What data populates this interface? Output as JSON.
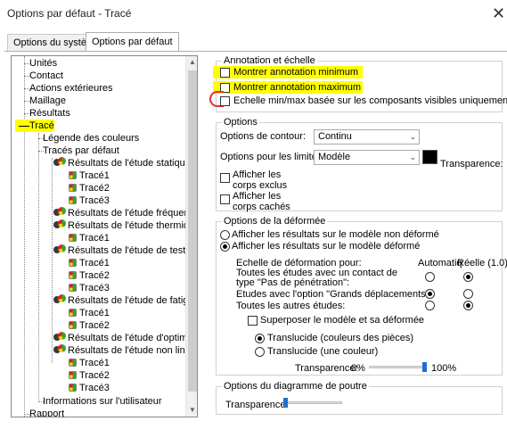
{
  "window": {
    "title": "Options par défaut - Tracé",
    "close_glyph": "✕"
  },
  "tabs": [
    {
      "label": "Options du système",
      "active": false
    },
    {
      "label": "Options par défaut",
      "active": true
    }
  ],
  "tree": {
    "items": [
      {
        "label": "Unités"
      },
      {
        "label": "Contact"
      },
      {
        "label": "Actions extérieures"
      },
      {
        "label": "Maillage"
      },
      {
        "label": "Résultats"
      },
      {
        "label": "Tracé",
        "selected": true
      },
      {
        "label": "Légende des couleurs"
      },
      {
        "label": "Tracés par défaut"
      },
      {
        "label": "Résultats de l'étude statique"
      },
      {
        "label": "Tracé1"
      },
      {
        "label": "Tracé2"
      },
      {
        "label": "Tracé3"
      },
      {
        "label": "Résultats de l'étude fréquentiel"
      },
      {
        "label": "Résultats de l'étude thermique"
      },
      {
        "label": "Tracé1"
      },
      {
        "label": "Résultats de l'étude de test de c"
      },
      {
        "label": "Tracé1"
      },
      {
        "label": "Tracé2"
      },
      {
        "label": "Tracé3"
      },
      {
        "label": "Résultats de l'étude de fatigue"
      },
      {
        "label": "Tracé1"
      },
      {
        "label": "Tracé2"
      },
      {
        "label": "Résultats de l'étude d'optimisa"
      },
      {
        "label": "Résultats de l'étude non linéair"
      },
      {
        "label": "Tracé1"
      },
      {
        "label": "Tracé2"
      },
      {
        "label": "Tracé3"
      },
      {
        "label": "Informations sur l'utilisateur"
      },
      {
        "label": "Rapport"
      }
    ]
  },
  "annotation": {
    "title": "Annotation et échelle",
    "show_min": "Montrer annotation minimum",
    "show_max": "Montrer annotation maximum",
    "scale_visible": "Echelle min/max basée sur les composants visibles uniquement"
  },
  "options": {
    "title": "Options",
    "contour_label": "Options de contour:",
    "contour_value": "Continu",
    "limits_label": "Options pour les limites:",
    "limits_value": "Modèle",
    "transparence_label": "Transparence:",
    "limit_color": "#000000",
    "show_excluded": "Afficher les corps exclus",
    "show_hidden": "Afficher les corps cachés"
  },
  "deformed": {
    "title": "Options de la déformée",
    "on_undeformed": "Afficher les résultats sur le modèle non déformé",
    "on_deformed": "Afficher les résultats sur le modèle déformé",
    "scale_header": "Echelle de déformation pour:",
    "col_auto": "Automatiq",
    "col_real": "Réelle (1.0)",
    "row1": "Toutes les études avec un contact de type \"Pas de pénétration\":",
    "row2": "Etudes avec l'option \"Grands déplacements\":",
    "row3": "Toutes les autres études:",
    "superimpose": "Superposer le modèle et sa déformée",
    "translucent_parts": "Translucide (couleurs des pièces)",
    "translucent_single": "Translucide (une couleur)",
    "transparence_label": "Transparence:",
    "transparence_min": "0%",
    "transparence_max": "100%",
    "transparence_value": 0.95
  },
  "beam": {
    "title": "Options du diagramme de poutre",
    "transparence_label": "Transparence:",
    "transparence_value": 0.0
  },
  "colors": {
    "highlight": "#ffff00",
    "accent": "#1f6fd1",
    "annotation_circle": "#e03030"
  }
}
